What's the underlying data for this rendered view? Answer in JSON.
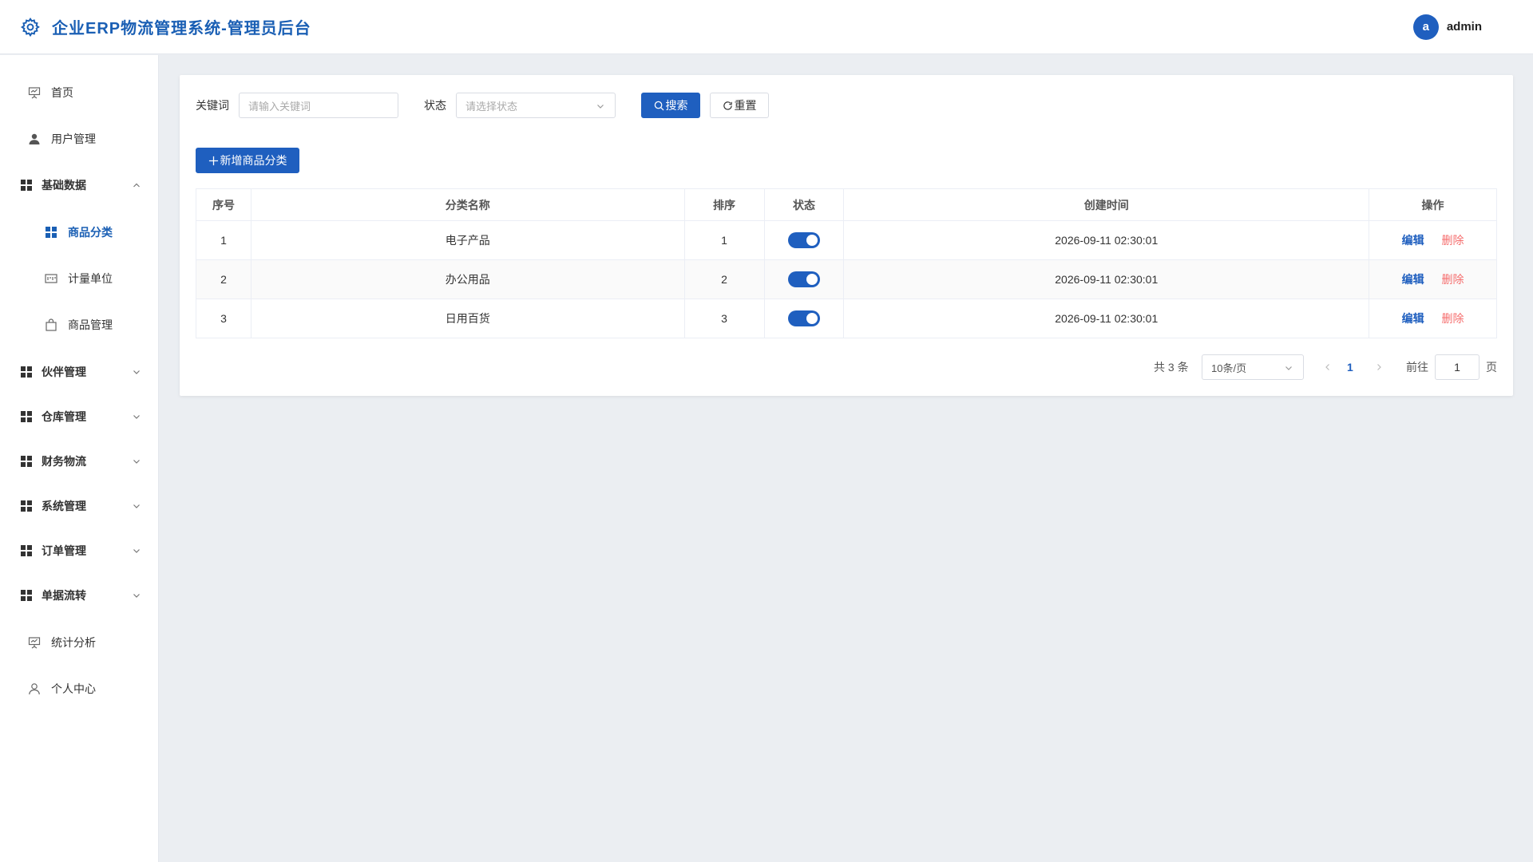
{
  "header": {
    "title": "企业ERP物流管理系统-管理员后台",
    "logo_icon": "gear-icon",
    "avatar_letter": "a",
    "username": "admin"
  },
  "sidebar": {
    "items": [
      {
        "label": "首页",
        "icon": "presentation-icon"
      },
      {
        "label": "用户管理",
        "icon": "user-icon"
      },
      {
        "label": "基础数据",
        "icon": "grid-icon",
        "expanded": true
      },
      {
        "label": "商品分类",
        "icon": "grid-icon",
        "active": true
      },
      {
        "label": "计量单位",
        "icon": "ruler-icon"
      },
      {
        "label": "商品管理",
        "icon": "bag-icon"
      },
      {
        "label": "伙伴管理",
        "icon": "grid-icon"
      },
      {
        "label": "仓库管理",
        "icon": "grid-icon"
      },
      {
        "label": "财务物流",
        "icon": "grid-icon"
      },
      {
        "label": "系统管理",
        "icon": "grid-icon"
      },
      {
        "label": "订单管理",
        "icon": "grid-icon"
      },
      {
        "label": "单据流转",
        "icon": "grid-icon"
      },
      {
        "label": "统计分析",
        "icon": "presentation-icon"
      },
      {
        "label": "个人中心",
        "icon": "user-outline-icon"
      }
    ]
  },
  "filters": {
    "keyword_label": "关键词",
    "keyword_placeholder": "请输入关键词",
    "status_label": "状态",
    "status_placeholder": "请选择状态",
    "search_label": "搜索",
    "reset_label": "重置"
  },
  "actions": {
    "add_label": "新增商品分类"
  },
  "table": {
    "columns": [
      "序号",
      "分类名称",
      "排序",
      "状态",
      "创建时间",
      "操作"
    ],
    "rows": [
      {
        "index": "1",
        "name": "电子产品",
        "sort": "1",
        "enabled": true,
        "created": "2026-09-11 02:30:01"
      },
      {
        "index": "2",
        "name": "办公用品",
        "sort": "2",
        "enabled": true,
        "created": "2026-09-11 02:30:01"
      },
      {
        "index": "3",
        "name": "日用百货",
        "sort": "3",
        "enabled": true,
        "created": "2026-09-11 02:30:01"
      }
    ],
    "edit_label": "编辑",
    "delete_label": "删除"
  },
  "pagination": {
    "total_text": "共 3 条",
    "page_size": "10条/页",
    "current_page": "1",
    "goto_label": "前往",
    "goto_value": "1",
    "page_suffix": "页"
  },
  "colors": {
    "primary": "#1f5fbf",
    "danger": "#f56c6c",
    "title": "#1a5fb4"
  }
}
